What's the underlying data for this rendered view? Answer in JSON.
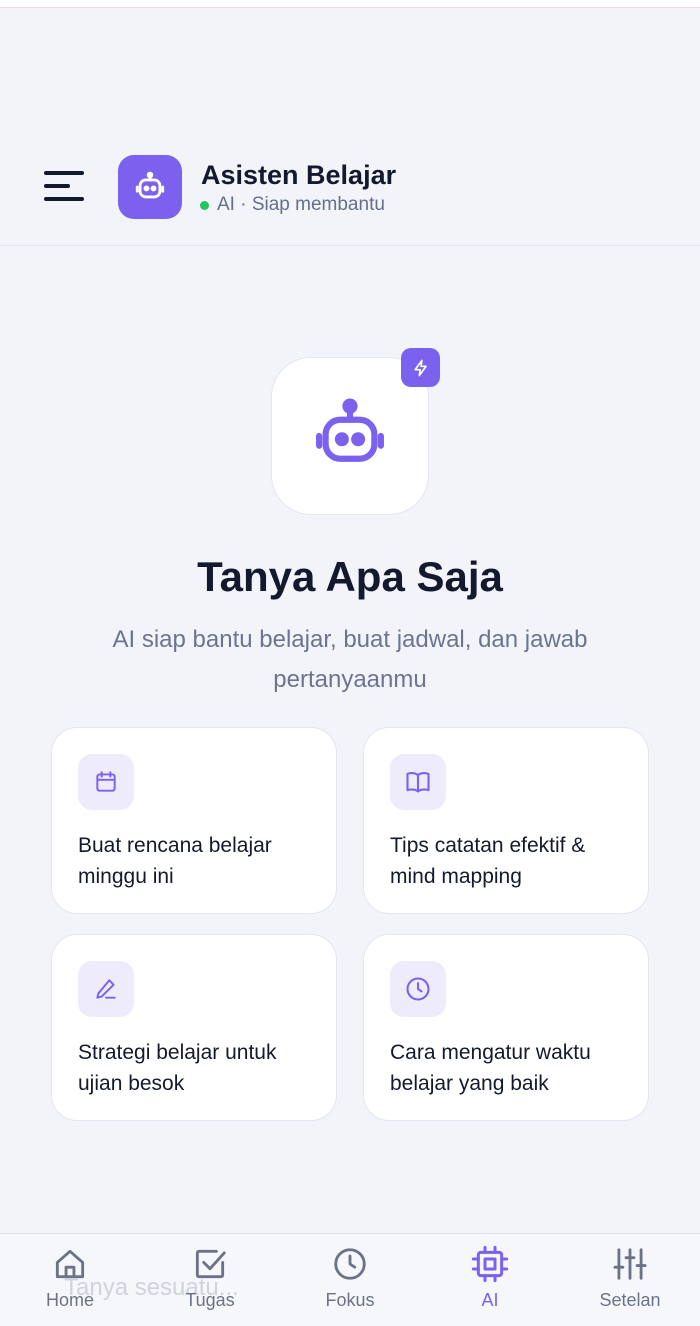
{
  "header": {
    "title": "Asisten Belajar",
    "status": "AI · Siap membantu",
    "menu_icon": "menu-icon",
    "avatar_icon": "robot-icon",
    "status_color": "#22c55e"
  },
  "hero": {
    "icon": "robot-icon",
    "badge_icon": "lightning-icon",
    "title": "Tanya Apa Saja",
    "subtitle": "AI siap bantu belajar, buat jadwal, dan jawab pertanyaanmu"
  },
  "suggestions": [
    {
      "icon": "calendar-icon",
      "label": "Buat rencana belajar minggu ini"
    },
    {
      "icon": "book-open-icon",
      "label": "Tips catatan efektif & mind mapping"
    },
    {
      "icon": "pencil-icon",
      "label": "Strategi belajar untuk ujian besok"
    },
    {
      "icon": "clock-icon",
      "label": "Cara mengatur waktu belajar yang baik"
    }
  ],
  "input": {
    "placeholder": "Tanya sesuatu..."
  },
  "nav": [
    {
      "icon": "home-icon",
      "label": "Home",
      "active": false
    },
    {
      "icon": "check-square-icon",
      "label": "Tugas",
      "active": false
    },
    {
      "icon": "clock-icon",
      "label": "Fokus",
      "active": false
    },
    {
      "icon": "cpu-icon",
      "label": "AI",
      "active": true
    },
    {
      "icon": "sliders-icon",
      "label": "Setelan",
      "active": false
    }
  ],
  "colors": {
    "accent": "#7b61ee",
    "accent_soft": "#eeebfb",
    "text": "#141a2e",
    "muted": "#6b7590",
    "background": "#f2f4fa"
  }
}
